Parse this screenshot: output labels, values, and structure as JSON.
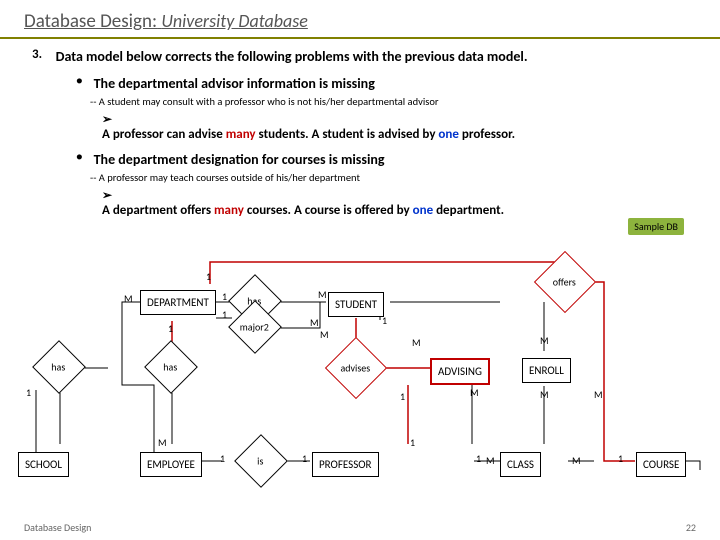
{
  "header": {
    "title_main": "Database Design:",
    "title_sub": "University Database"
  },
  "point": {
    "num": "3.",
    "text": "Data model below corrects the following problems with the previous data model."
  },
  "b1": {
    "title": "The departmental advisor information is missing",
    "dash": "-- A student may consult with a professor who is not his/her departmental advisor",
    "arrow_pre1": "A professor can advise ",
    "arrow_many1": "many",
    "arrow_mid1": " students. A student is advised by ",
    "arrow_one1": "one",
    "arrow_post1": " professor."
  },
  "b2": {
    "title": "The department designation for courses is missing",
    "dash": "-- A professor may teach courses outside of his/her department",
    "arrow_pre2": "A department offers ",
    "arrow_many2": "many",
    "arrow_mid2": " courses. A course is offered by ",
    "arrow_one2": "one",
    "arrow_post2": " department."
  },
  "badge": "Sample DB",
  "ent": {
    "dept": "DEPARTMENT",
    "student": "STUDENT",
    "school": "SCHOOL",
    "employee": "EMPLOYEE",
    "professor": "PROFESSOR",
    "class": "CLASS",
    "course": "COURSE",
    "advising": "ADVISING",
    "enroll": "ENROLL"
  },
  "rel": {
    "has": "has",
    "major2": "major2",
    "is": "is",
    "advises": "advises",
    "offers": "offers"
  },
  "card": {
    "one": "1",
    "m": "M"
  },
  "footer": {
    "left": "Database Design",
    "right": "22"
  }
}
